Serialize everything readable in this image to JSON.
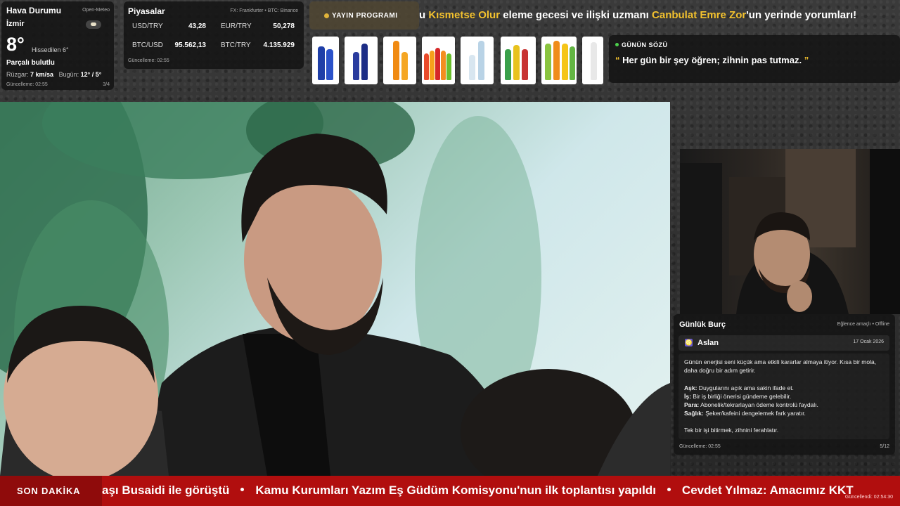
{
  "weather": {
    "title": "Hava Durumu",
    "source": "Open-Meteo",
    "city": "İzmir",
    "temp": "8°",
    "feels": "Hissedilen 6°",
    "condition": "Parçalı bulutlu",
    "wind_label": "Rüzgar:",
    "wind_value": "7 km/sa",
    "today_label": "Bugün:",
    "today_value": "12° / 5°",
    "updated": "Güncelleme: 02:55",
    "page": "3/4",
    "icon": "partly-cloudy-icon"
  },
  "markets": {
    "title": "Piyasalar",
    "source": "FX: Frankfurter • BTC: Binance",
    "rows": [
      {
        "label": "USD/TRY",
        "value": "43,28"
      },
      {
        "label": "EUR/TRY",
        "value": "50,278"
      },
      {
        "label": "BTC/USD",
        "value": "95.562,13"
      },
      {
        "label": "BTC/TRY",
        "value": "4.135.929"
      }
    ],
    "updated": "Güncelleme: 02:55"
  },
  "banner": {
    "label": "YAYIN PROGRAMI",
    "text_a": "u ",
    "highlight_a": "Kısmetse Olur",
    "text_b": " eleme gecesi ve ilişki uzmanı ",
    "highlight_b": "Canbulat Emre Zor",
    "text_c": "'un yerinde yorumları!"
  },
  "quote": {
    "title": "GÜNÜN SÖZÜ",
    "open": "“",
    "text": " Her gün bir şey öğren; zihnin pas tutmaz. ",
    "close": "”"
  },
  "horoscope": {
    "title": "Günlük Burç",
    "status": "Eğlence amaçlı • Offline",
    "sign": "Aslan",
    "sign_icon": "leo-icon",
    "date": "17 Ocak 2026",
    "intro": "Günün enerjisi seni küçük ama etkili kararlar almaya itiyor. Kısa bir mola, daha doğru bir adım getirir.",
    "love_label": "Aşk:",
    "love": " Duygularını açık ama sakin ifade et.",
    "work_label": "İş:",
    "work": " Bir iş birliği önerisi gündeme gelebilir.",
    "money_label": "Para:",
    "money": " Abonelik/tekrarlayan ödeme kontrolü faydalı.",
    "health_label": "Sağlık:",
    "health": " Şeker/kafeini dengelemek fark yaratır.",
    "outro": "Tek bir işi bitirmek, zihnini ferahlatır.",
    "updated": "Güncelleme: 02:55",
    "page": "5/12"
  },
  "ticker": {
    "label": "SON DAKİKA",
    "items": [
      "aşı Busaidi ile görüştü",
      "Kamu Kurumları Yazım Eş Güdüm Komisyonu'nun ilk toplantısı yapıldı",
      "Cevdet Yılmaz: Amacımız KKT"
    ],
    "updated": "Güncellendi: 02:54:30"
  },
  "colors": {
    "accent": "#f2c12e",
    "ticker_bg": "#b10e0e",
    "panel_bg": "#141414"
  }
}
